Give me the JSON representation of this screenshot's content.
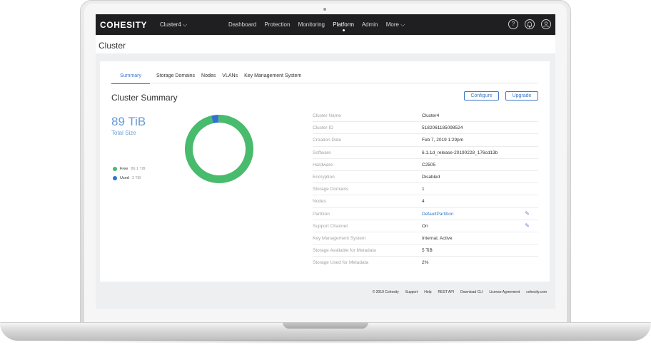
{
  "topbar": {
    "logo": "COHESITY",
    "cluster_select": "Cluster4",
    "nav": [
      "Dashboard",
      "Protection",
      "Monitoring",
      "Platform",
      "Admin",
      "More"
    ],
    "active_nav": "Platform"
  },
  "page_title": "Cluster",
  "tabs": [
    "Summary",
    "Storage Domains",
    "Nodes",
    "VLANs",
    "Key Management System"
  ],
  "active_tab": "Summary",
  "summary": {
    "title": "Cluster Summary",
    "configure_label": "Configure",
    "upgrade_label": "Upgrade",
    "total_size_value": "89 TiB",
    "total_size_label": "Total Size"
  },
  "legend": [
    {
      "name": "Free",
      "value": "86.1 TiB",
      "color": "#48bb6c"
    },
    {
      "name": "Used",
      "value": "3 TiB",
      "color": "#2f72d4"
    }
  ],
  "chart_data": {
    "type": "pie",
    "style": "donut",
    "categories": [
      "Free",
      "Used"
    ],
    "values": [
      86.1,
      3
    ],
    "colors": [
      "#48bb6c",
      "#2f72d4"
    ]
  },
  "properties": [
    {
      "key": "Cluster Name",
      "value": "Cluster4"
    },
    {
      "key": "Cluster ID",
      "value": "5182061185098524"
    },
    {
      "key": "Creation Date",
      "value": "Feb 7, 2019 1:29pm"
    },
    {
      "key": "Software",
      "value": "6.1.1d_release-20190228_176cd13b"
    },
    {
      "key": "Hardware",
      "value": "C2505"
    },
    {
      "key": "Encryption",
      "value": "Disabled"
    },
    {
      "key": "Storage Domains",
      "value": "1"
    },
    {
      "key": "Nodes",
      "value": "4"
    },
    {
      "key": "Partition",
      "value": "DefaultPartition"
    },
    {
      "key": "Support Channel",
      "value": "On"
    },
    {
      "key": "Key Management System",
      "value": "Internal, Active"
    },
    {
      "key": "Storage Available for Metadata",
      "value": "5 TiB"
    },
    {
      "key": "Storage Used for Metadata",
      "value": "2%"
    }
  ],
  "footer": {
    "copyright": "© 2019 Cohesity",
    "links": [
      "Support",
      "Help",
      "REST API",
      "Download CLI",
      "License Agreement",
      "cohesity.com"
    ]
  }
}
